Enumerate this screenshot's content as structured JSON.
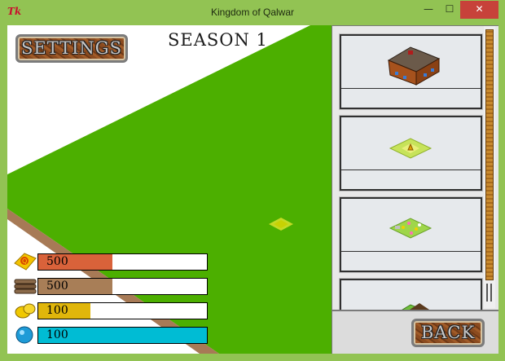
{
  "window": {
    "app_icon": "Tk",
    "title": "Kingdom of Qalwar",
    "minimize_glyph": "—",
    "maximize_glyph": "☐",
    "close_glyph": "✕"
  },
  "hud": {
    "settings_label": "SETTINGS",
    "season_label": "SEASON 1"
  },
  "resources": [
    {
      "name": "gold-coins",
      "icon": "coin-icon",
      "value": "500",
      "fill": 0.44,
      "color": "#d9623a"
    },
    {
      "name": "wood",
      "icon": "wood-logs-icon",
      "value": "500",
      "fill": 0.44,
      "color": "#a87e57"
    },
    {
      "name": "food",
      "icon": "lemon-icon",
      "value": "100",
      "fill": 0.31,
      "color": "#e0b60b"
    },
    {
      "name": "water",
      "icon": "water-orb-icon",
      "value": "100",
      "fill": 1.0,
      "color": "#00bcd4"
    }
  ],
  "build_list": [
    {
      "name": "house",
      "icon": "house-building-icon",
      "label": ""
    },
    {
      "name": "field",
      "icon": "wheat-field-tile-icon",
      "label": ""
    },
    {
      "name": "garden",
      "icon": "flower-garden-tile-icon",
      "label": ""
    },
    {
      "name": "mound",
      "icon": "dirt-mound-tile-icon",
      "label": ""
    }
  ],
  "footer": {
    "back_label": "BACK"
  },
  "colors": {
    "grass": "#4caf00",
    "path": "#a77a56",
    "window_chrome": "#92c353"
  }
}
